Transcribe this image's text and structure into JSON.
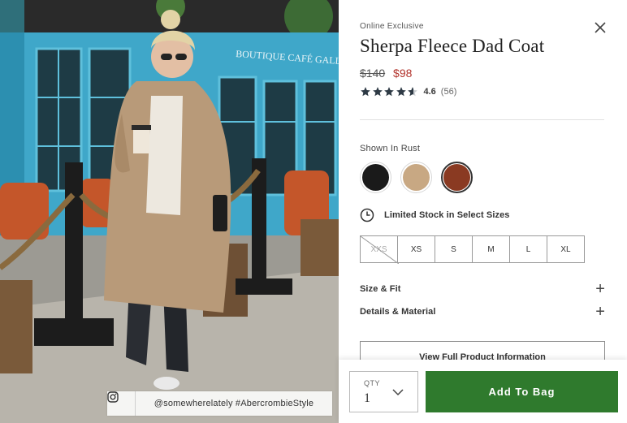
{
  "photo": {
    "storefront_sign": "BOUTIQUE CAFÉ GALLERY",
    "credit_text": "@somewherelately  #AbercrombieStyle",
    "credit_icon": "instagram-icon"
  },
  "product": {
    "eyebrow": "Online Exclusive",
    "title": "Sherpa Fleece Dad Coat",
    "price_was": "$140",
    "price_now": "$98",
    "rating_value": "4.6",
    "rating_count": "(56)",
    "rating_stars": 4.6
  },
  "color": {
    "label": "Shown In Rust",
    "swatches": [
      {
        "name": "black",
        "hex": "#1a1a1a",
        "selected": false
      },
      {
        "name": "tan",
        "hex": "#c8a883",
        "selected": false
      },
      {
        "name": "rust",
        "hex": "#8a3a22",
        "selected": true
      }
    ]
  },
  "stock": {
    "icon": "clock-icon",
    "text": "Limited Stock in Select Sizes"
  },
  "sizes": [
    {
      "label": "XXS",
      "available": false
    },
    {
      "label": "XS",
      "available": true
    },
    {
      "label": "S",
      "available": true
    },
    {
      "label": "M",
      "available": true
    },
    {
      "label": "L",
      "available": true
    },
    {
      "label": "XL",
      "available": true
    }
  ],
  "accordions": [
    {
      "label": "Size & Fit"
    },
    {
      "label": "Details & Material"
    }
  ],
  "full_info_label": "View Full Product Information",
  "cart": {
    "qty_label": "QTY",
    "qty_value": "1",
    "add_label": "Add To Bag",
    "accent": "#2f7a2d"
  },
  "colors": {
    "sale_price": "#b2332c",
    "storefront": "#3fa7c9"
  }
}
